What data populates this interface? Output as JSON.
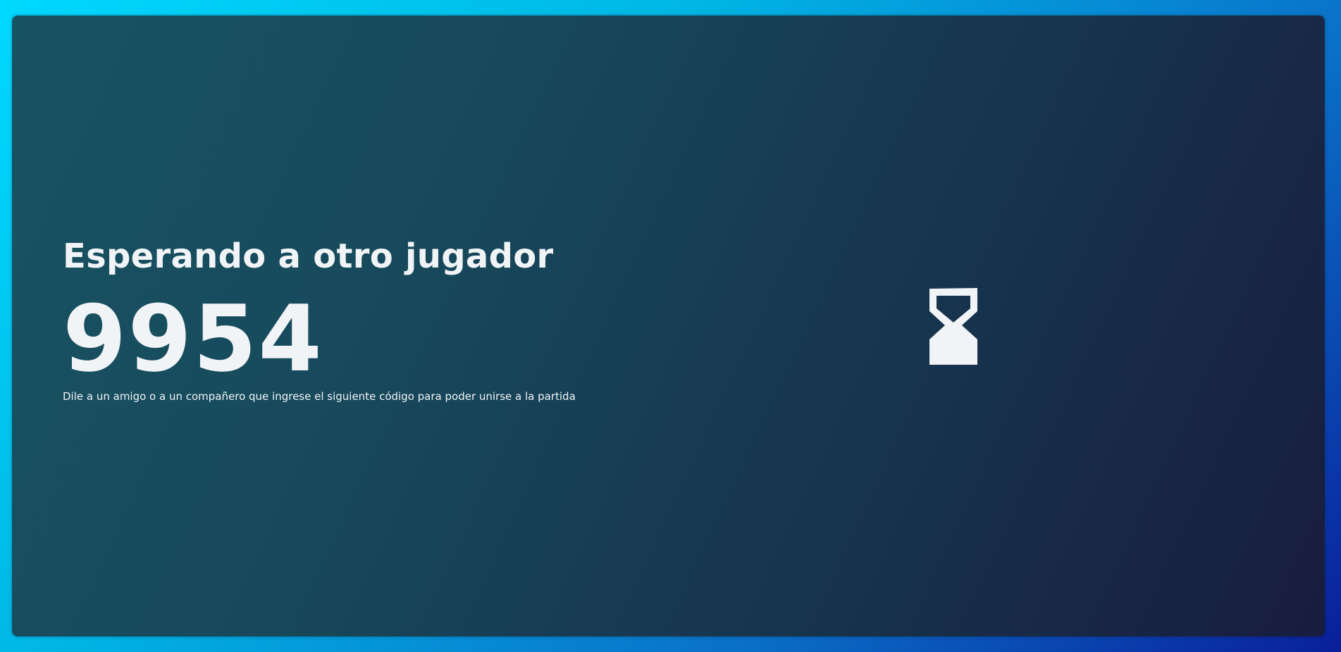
{
  "waiting": {
    "title": "Esperando a otro jugador",
    "code": "9954",
    "hint": "Dile a un amigo o a un compañero que ingrese el siguiente código para poder unirse a la partida"
  },
  "icon": "hourglass-icon",
  "colors": {
    "text": "#f1f4f7",
    "card_start": "#185362",
    "card_end": "#181c3e",
    "background_start": "#00d9ff",
    "background_end": "#0a1f9a"
  }
}
